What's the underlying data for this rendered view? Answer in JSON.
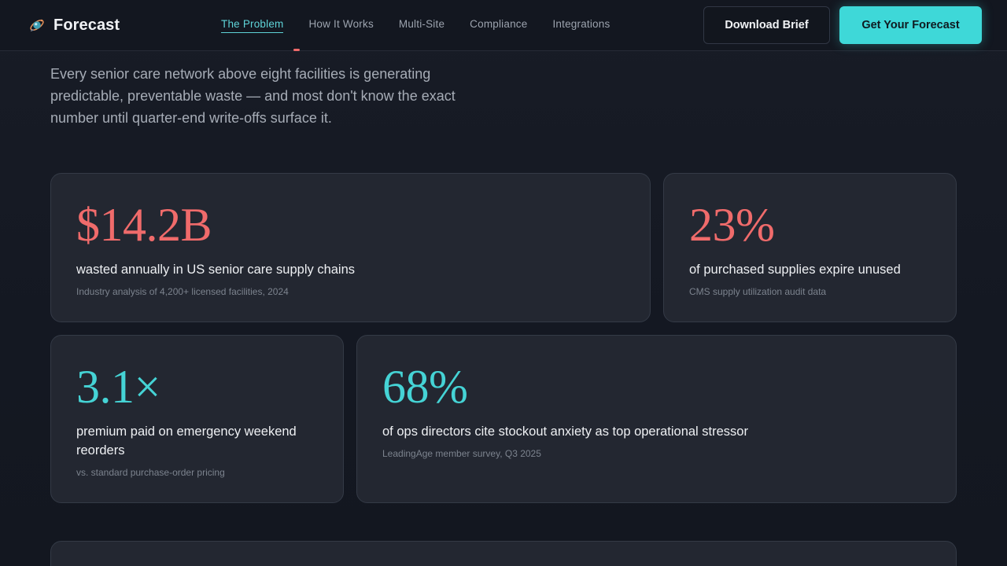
{
  "brand": {
    "name": "Forecast",
    "icon": "brand-satellite-icon"
  },
  "nav": {
    "links": [
      {
        "label": "The Problem",
        "active": true
      },
      {
        "label": "How It Works",
        "active": false
      },
      {
        "label": "Multi-Site",
        "active": false
      },
      {
        "label": "Compliance",
        "active": false
      },
      {
        "label": "Integrations",
        "active": false
      }
    ],
    "download_label": "Download Brief",
    "cta_label": "Get Your Forecast"
  },
  "intro": {
    "text": "Every senior care network above eight facilities is generating predictable, preventable waste — and most don't know the exact number until quarter-end write-offs surface it."
  },
  "stats": [
    {
      "value": "$14.2B",
      "label": "wasted annually in US senior care supply chains",
      "source": "Industry analysis of 4,200+ licensed facilities, 2024",
      "color": "#f06b6b"
    },
    {
      "value": "23%",
      "label": "of purchased supplies expire unused",
      "source": "CMS supply utilization audit data",
      "color": "#f06b6b"
    },
    {
      "value": "3.1×",
      "label": "premium paid on emergency weekend reorders",
      "source": "vs. standard purchase-order pricing",
      "color": "#45d3d5"
    },
    {
      "value": "68%",
      "label": "of ops directors cite stockout anxiety as top operational stressor",
      "source": "LeadingAge member survey, Q3 2025",
      "color": "#45d3d5"
    }
  ],
  "colors": {
    "accent": "#3ed8d8",
    "warning": "#f06b6b",
    "background": "#161a23",
    "card": "#232731"
  }
}
